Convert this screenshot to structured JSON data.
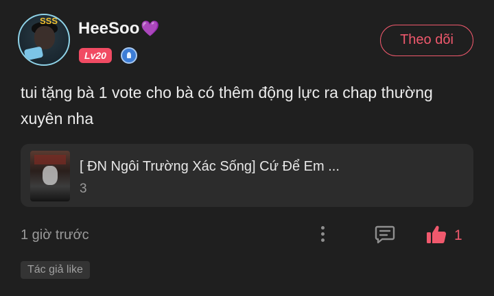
{
  "user": {
    "name": "HeeSoo",
    "name_emoji": "💜",
    "level": "Lv20",
    "avatar_sticker": "SSS",
    "medal_icon": "medal-icon"
  },
  "follow_button": {
    "label": "Theo dõi"
  },
  "comment": {
    "text": "tui tặng bà 1 vote cho bà có thêm động lực ra chap thường xuyên nha"
  },
  "story": {
    "title": "[ ĐN Ngôi Trường Xác Sống] Cứ Để Em ...",
    "chapter": "3"
  },
  "footer": {
    "timestamp": "1 giờ trước",
    "like_count": "1",
    "icons": [
      "more-vertical-icon",
      "reply-icon",
      "like-icon"
    ]
  },
  "tag": {
    "label": "Tác giả like"
  },
  "colors": {
    "background": "#1f1f1f",
    "accent": "#f0596d",
    "level_badge": "#f14b63",
    "card": "#2c2c2c"
  }
}
